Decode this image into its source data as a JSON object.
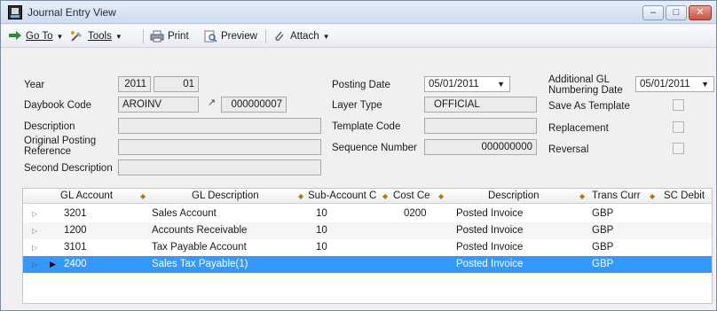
{
  "window": {
    "title": "Journal Entry View"
  },
  "toolbar": {
    "goto_label": "Go To",
    "tools_label": "Tools",
    "print_label": "Print",
    "preview_label": "Preview",
    "attach_label": "Attach"
  },
  "form": {
    "year_label": "Year",
    "year": "2011",
    "period": "01",
    "daybook_label": "Daybook Code",
    "daybook_code": "AROINV",
    "daybook_number": "000000007",
    "description_label": "Description",
    "description": "",
    "orig_ref_label_1": "Original Posting",
    "orig_ref_label_2": "Reference",
    "orig_ref": "",
    "second_desc_label": "Second Description",
    "second_desc": "",
    "posting_date_label": "Posting Date",
    "posting_date": "05/01/2011",
    "layer_type_label": "Layer Type",
    "layer_type": "OFFICIAL",
    "template_code_label": "Template Code",
    "template_code": "",
    "sequence_label": "Sequence Number",
    "sequence_number": "000000000",
    "addl_gl_label_1": "Additional GL",
    "addl_gl_label_2": "Numbering Date",
    "addl_gl_date": "05/01/2011",
    "save_template_label": "Save As Template",
    "replacement_label": "Replacement",
    "reversal_label": "Reversal"
  },
  "grid": {
    "columns": [
      "GL Account",
      "GL Description",
      "Sub-Account C",
      "Cost Ce",
      "Description",
      "Trans Curr",
      "SC Debit"
    ],
    "rows": [
      {
        "account": "3201",
        "gl_desc": "Sales Account",
        "sub": "10",
        "cost": "0200",
        "desc": "Posted Invoice",
        "curr": "GBP",
        "debit": ""
      },
      {
        "account": "1200",
        "gl_desc": "Accounts Receivable",
        "sub": "10",
        "cost": "",
        "desc": "Posted Invoice",
        "curr": "GBP",
        "debit": ""
      },
      {
        "account": "3101",
        "gl_desc": "Tax Payable Account",
        "sub": "10",
        "cost": "",
        "desc": "Posted Invoice",
        "curr": "GBP",
        "debit": ""
      },
      {
        "account": "2400",
        "gl_desc": "Sales Tax Payable(1)",
        "sub": "",
        "cost": "",
        "desc": "Posted Invoice",
        "curr": "GBP",
        "debit": ""
      }
    ]
  },
  "colors": {
    "selection": "#3399ff",
    "sort_arrow": "#b07a00"
  }
}
